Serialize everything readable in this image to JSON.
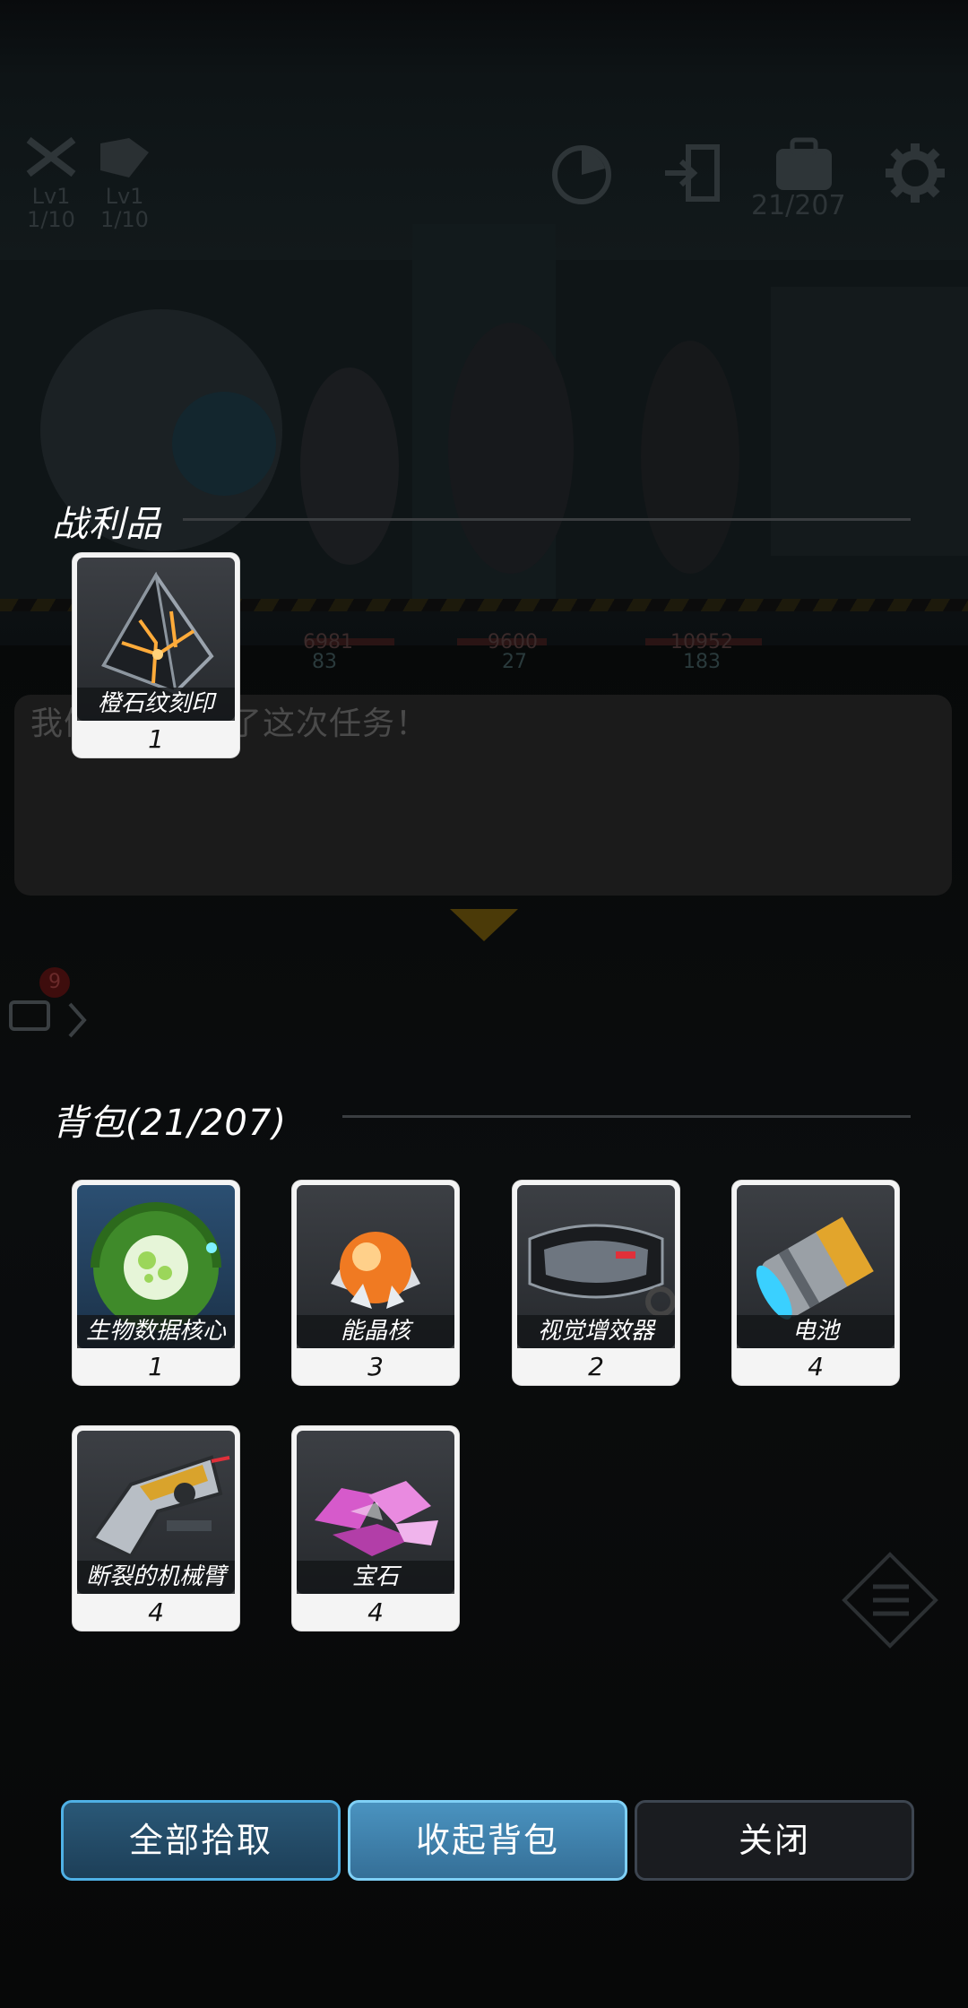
{
  "hud": {
    "skill1_level": "Lv1",
    "skill1_count": "1/10",
    "skill2_level": "Lv1",
    "skill2_count": "1/10",
    "bag_count": "21/207",
    "icons": [
      "radar-icon",
      "exit-icon",
      "backpack-icon",
      "gear-icon"
    ]
  },
  "background": {
    "hp_values": [
      "6981",
      "9600",
      "10952"
    ],
    "energy_values": [
      "83",
      "27",
      "183"
    ],
    "chat_text": "我们顺利完成了这次任务！",
    "chat_badge": "9"
  },
  "loot": {
    "title": "战利品",
    "items": [
      {
        "name": "橙石纹刻印",
        "count": "1",
        "icon": "orange-rune-icon"
      }
    ]
  },
  "backpack": {
    "title": "背包(21/207)",
    "items": [
      {
        "name": "生物数据核心",
        "count": "1",
        "icon": "bio-data-core-icon"
      },
      {
        "name": "能晶核",
        "count": "3",
        "icon": "energy-crystal-icon"
      },
      {
        "name": "视觉增效器",
        "count": "2",
        "icon": "visor-icon"
      },
      {
        "name": "电池",
        "count": "4",
        "icon": "battery-icon"
      },
      {
        "name": "断裂的机械臂",
        "count": "4",
        "icon": "broken-arm-icon"
      },
      {
        "name": "宝石",
        "count": "4",
        "icon": "gem-icon"
      }
    ]
  },
  "buttons": {
    "pick_all": "全部拾取",
    "collapse": "收起背包",
    "close": "关闭"
  },
  "colors": {
    "accent_blue": "#4fb1e6",
    "card_bg": "#f4f4f4",
    "overlay": "#050607"
  }
}
